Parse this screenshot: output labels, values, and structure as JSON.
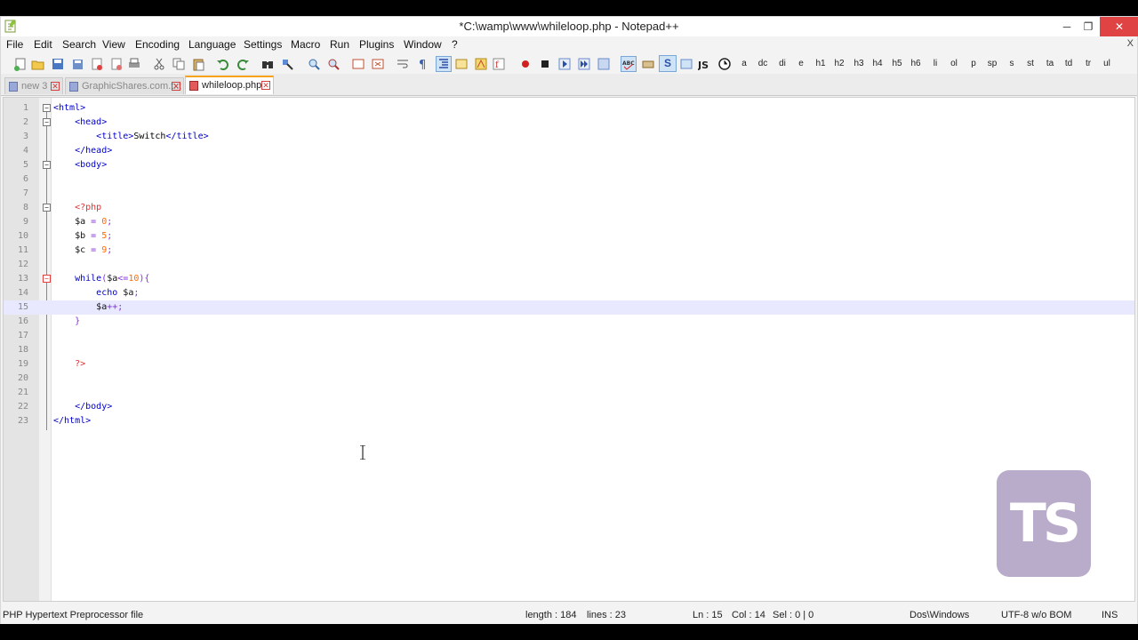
{
  "window": {
    "title": "*C:\\wamp\\www\\whileloop.php - Notepad++",
    "controls": {
      "minimize": "─",
      "restore": "❐",
      "close": "✕"
    }
  },
  "menu": {
    "items": [
      "File",
      "Edit",
      "Search",
      "View",
      "Encoding",
      "Language",
      "Settings",
      "Macro",
      "Run",
      "Plugins",
      "Window",
      "?"
    ],
    "close_glyph": "X"
  },
  "toolbar": {
    "html_tags": [
      "a",
      "dc",
      "di",
      "e",
      "h1",
      "h2",
      "h3",
      "h4",
      "h5",
      "h6",
      "li",
      "ol",
      "p",
      "sp",
      "s",
      "st",
      "ta",
      "td",
      "tr",
      "ul"
    ],
    "bold_s": "S"
  },
  "tabs": [
    {
      "label": "new  3",
      "active": false
    },
    {
      "label": "GraphicShares.com.txt",
      "active": false
    },
    {
      "label": "whileloop.php",
      "active": true
    }
  ],
  "editor": {
    "current_line": 15,
    "lines": [
      {
        "n": "1",
        "text": "<html>"
      },
      {
        "n": "2",
        "text": "    <head>"
      },
      {
        "n": "3",
        "text": "        <title>Switch</title>"
      },
      {
        "n": "4",
        "text": "    </head>"
      },
      {
        "n": "5",
        "text": "    <body>"
      },
      {
        "n": "6",
        "text": ""
      },
      {
        "n": "7",
        "text": ""
      },
      {
        "n": "8",
        "text": "    <?php"
      },
      {
        "n": "9",
        "text": "    $a = 0;"
      },
      {
        "n": "10",
        "text": "    $b = 5;"
      },
      {
        "n": "11",
        "text": "    $c = 9;"
      },
      {
        "n": "12",
        "text": ""
      },
      {
        "n": "13",
        "text": "    while($a<=10){"
      },
      {
        "n": "14",
        "text": "        echo $a;"
      },
      {
        "n": "15",
        "text": "        $a++;"
      },
      {
        "n": "16",
        "text": "    }"
      },
      {
        "n": "17",
        "text": ""
      },
      {
        "n": "18",
        "text": ""
      },
      {
        "n": "19",
        "text": "    ?>"
      },
      {
        "n": "20",
        "text": ""
      },
      {
        "n": "21",
        "text": ""
      },
      {
        "n": "22",
        "text": "    </body>"
      },
      {
        "n": "23",
        "text": "</html>"
      }
    ]
  },
  "status": {
    "file_type": "PHP Hypertext Preprocessor file",
    "length": "length : 184",
    "lines": "lines : 23",
    "ln": "Ln : 15",
    "col": "Col : 14",
    "sel": "Sel : 0 | 0",
    "eol": "Dos\\Windows",
    "encoding": "UTF-8 w/o BOM",
    "mode": "INS"
  },
  "watermark": {
    "text": "TS"
  },
  "colors": {
    "accent_tab": "#f7a31a",
    "current_line": "#e8e8ff",
    "tag_blue": "#0000cc",
    "php_red": "#e03030",
    "number_orange": "#ff6a00"
  }
}
